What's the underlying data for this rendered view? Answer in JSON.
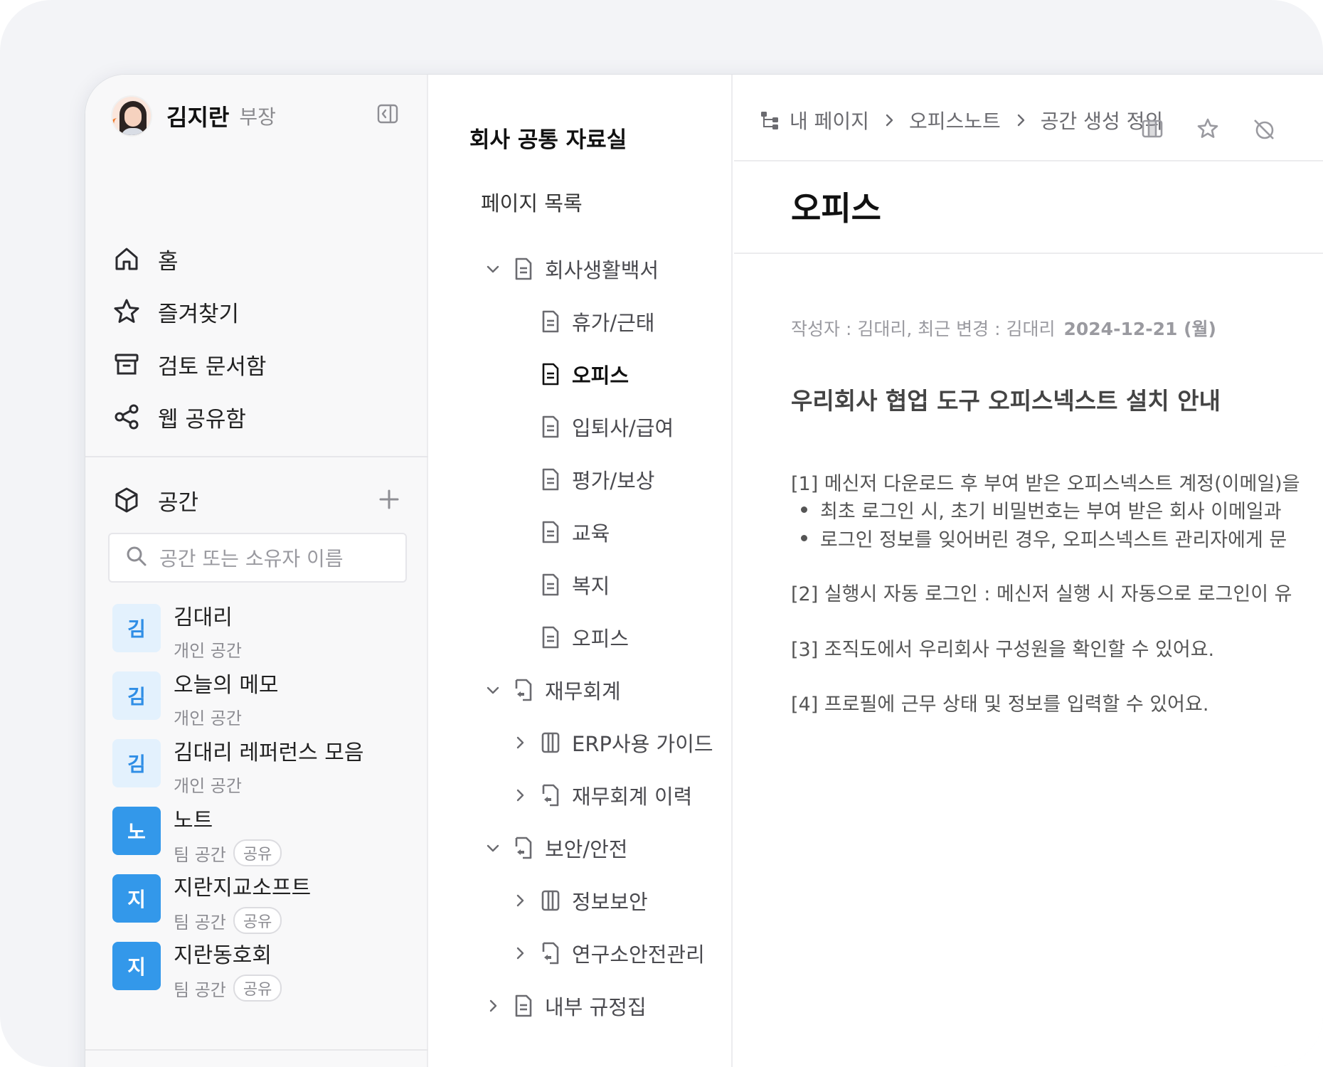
{
  "profile": {
    "name": "김지란",
    "role": "부장"
  },
  "nav": [
    {
      "label": "홈",
      "icon": "home-icon"
    },
    {
      "label": "즐겨찾기",
      "icon": "star-icon"
    },
    {
      "label": "검토 문서함",
      "icon": "archive-icon"
    },
    {
      "label": "웹 공유함",
      "icon": "share-icon"
    }
  ],
  "spaces_section": {
    "label": "공간",
    "search_placeholder": "공간 또는 소유자 이름"
  },
  "spaces": [
    {
      "badge": "김",
      "name": "김대리",
      "sub": "개인 공간",
      "shared": "",
      "badge_bg": "#e3f1fd",
      "badge_fg": "#2f8ee6"
    },
    {
      "badge": "김",
      "name": "오늘의 메모",
      "sub": "개인 공간",
      "shared": "",
      "badge_bg": "#e3f1fd",
      "badge_fg": "#2f8ee6"
    },
    {
      "badge": "김",
      "name": "김대리 레퍼런스 모음",
      "sub": "개인 공간",
      "shared": "",
      "badge_bg": "#e3f1fd",
      "badge_fg": "#2f8ee6"
    },
    {
      "badge": "노",
      "name": "노트",
      "sub": "팀 공간",
      "shared": "공유",
      "badge_bg": "#3398ea",
      "badge_fg": "#ffffff"
    },
    {
      "badge": "지",
      "name": "지란지교소프트",
      "sub": "팀 공간",
      "shared": "공유",
      "badge_bg": "#3398ea",
      "badge_fg": "#ffffff"
    },
    {
      "badge": "지",
      "name": "지란동호회",
      "sub": "팀 공간",
      "shared": "공유",
      "badge_bg": "#3398ea",
      "badge_fg": "#ffffff"
    }
  ],
  "tree": {
    "title": "회사 공통 자료실",
    "subtitle": "페이지 목록",
    "items": [
      {
        "label": "회사생활백서",
        "level": 0,
        "chevron": "down",
        "icon": "doc"
      },
      {
        "label": "휴가/근태",
        "level": 1,
        "chevron": "none",
        "icon": "doc"
      },
      {
        "label": "오피스",
        "level": 1,
        "chevron": "none",
        "icon": "doc",
        "active": true
      },
      {
        "label": "입퇴사/급여",
        "level": 1,
        "chevron": "none",
        "icon": "doc"
      },
      {
        "label": "평가/보상",
        "level": 1,
        "chevron": "none",
        "icon": "doc"
      },
      {
        "label": "교육",
        "level": 1,
        "chevron": "none",
        "icon": "doc"
      },
      {
        "label": "복지",
        "level": 1,
        "chevron": "none",
        "icon": "doc"
      },
      {
        "label": "오피스",
        "level": 1,
        "chevron": "none",
        "icon": "doc"
      },
      {
        "label": "재무회계",
        "level": 0,
        "chevron": "down",
        "icon": "link-doc"
      },
      {
        "label": "ERP사용 가이드",
        "level": 1,
        "chevron": "right",
        "icon": "book"
      },
      {
        "label": "재무회계 이력",
        "level": 1,
        "chevron": "right",
        "icon": "link-doc"
      },
      {
        "label": "보안/안전",
        "level": 0,
        "chevron": "down",
        "icon": "link-doc"
      },
      {
        "label": "정보보안",
        "level": 1,
        "chevron": "right",
        "icon": "book"
      },
      {
        "label": "연구소안전관리",
        "level": 1,
        "chevron": "right",
        "icon": "link-doc"
      },
      {
        "label": "내부 규정집",
        "level": 0,
        "chevron": "right",
        "icon": "doc"
      }
    ]
  },
  "breadcrumb": [
    "내 페이지",
    "오피스노트",
    "공간 생성 정의"
  ],
  "document": {
    "title": "오피스",
    "meta": "작성자 : 김대리,  최근 변경 : 김대리",
    "date": "2024-12-21 (월)",
    "heading": "우리회사 협업 도구 오피스넥스트 설치 안내",
    "p1": "[1] 메신저 다운로드 후 부여 받은 오피스넥스트 계정(이메일)을",
    "b1": "최초 로그인 시, 초기 비밀번호는 부여 받은 회사 이메일과",
    "b2": "로그인 정보를 잊어버린 경우, 오피스넥스트 관리자에게 문",
    "p2": "[2] 실행시 자동 로그인 : 메신저 실행 시 자동으로 로그인이 유",
    "p3": "[3] 조직도에서 우리회사 구성원을 확인할 수 있어요.",
    "p4": "[4] 프로필에 근무 상태 및 정보를 입력할 수 있어요."
  }
}
